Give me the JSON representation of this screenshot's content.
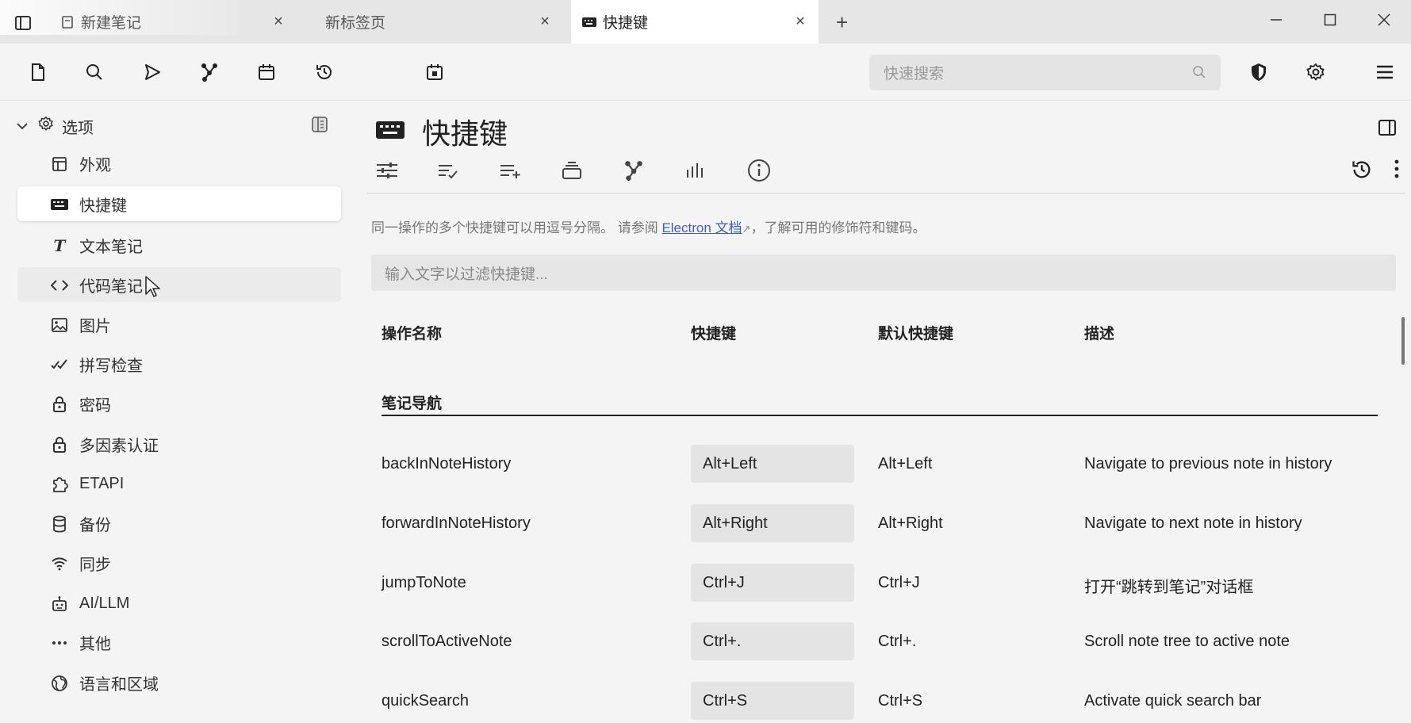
{
  "tabs": [
    {
      "label": "新建笔记"
    },
    {
      "label": "新标签页"
    },
    {
      "label": "快捷键"
    }
  ],
  "search": {
    "placeholder": "快速搜索"
  },
  "sidebar": {
    "header": "选项",
    "items": [
      {
        "label": "外观",
        "icon": "layout-icon"
      },
      {
        "label": "快捷键",
        "icon": "keyboard-icon"
      },
      {
        "label": "文本笔记",
        "icon": "text-icon"
      },
      {
        "label": "代码笔记",
        "icon": "code-icon"
      },
      {
        "label": "图片",
        "icon": "image-icon"
      },
      {
        "label": "拼写检查",
        "icon": "spellcheck-icon"
      },
      {
        "label": "密码",
        "icon": "lock-icon"
      },
      {
        "label": "多因素认证",
        "icon": "lock-icon"
      },
      {
        "label": "ETAPI",
        "icon": "puzzle-icon"
      },
      {
        "label": "备份",
        "icon": "database-icon"
      },
      {
        "label": "同步",
        "icon": "wifi-icon"
      },
      {
        "label": "AI/LLM",
        "icon": "robot-icon"
      },
      {
        "label": "其他",
        "icon": "dots-icon"
      },
      {
        "label": "语言和区域",
        "icon": "globe-icon"
      }
    ]
  },
  "main": {
    "title": "快捷键",
    "hint_before": "同一操作的多个快捷键可以用逗号分隔。 请参阅 ",
    "hint_link": "Electron 文档",
    "hint_after": "，了解可用的修饰符和键码。",
    "filter_placeholder": "输入文字以过滤快捷键...",
    "columns": [
      "操作名称",
      "快捷键",
      "默认快捷键",
      "描述"
    ],
    "section": "笔记导航",
    "rows": [
      {
        "name": "backInNoteHistory",
        "shortcut": "Alt+Left",
        "default": "Alt+Left",
        "desc": "Navigate to previous note in history"
      },
      {
        "name": "forwardInNoteHistory",
        "shortcut": "Alt+Right",
        "default": "Alt+Right",
        "desc": "Navigate to next note in history"
      },
      {
        "name": "jumpToNote",
        "shortcut": "Ctrl+J",
        "default": "Ctrl+J",
        "desc": "打开“跳转到笔记”对话框"
      },
      {
        "name": "scrollToActiveNote",
        "shortcut": "Ctrl+.",
        "default": "Ctrl+.",
        "desc": "Scroll note tree to active note"
      },
      {
        "name": "quickSearch",
        "shortcut": "Ctrl+S",
        "default": "Ctrl+S",
        "desc": "Activate quick search bar"
      }
    ]
  },
  "colors": {
    "accent_link": "#3b5bdb",
    "active_tab": "#ffffff",
    "background": "#f4f4f4"
  }
}
